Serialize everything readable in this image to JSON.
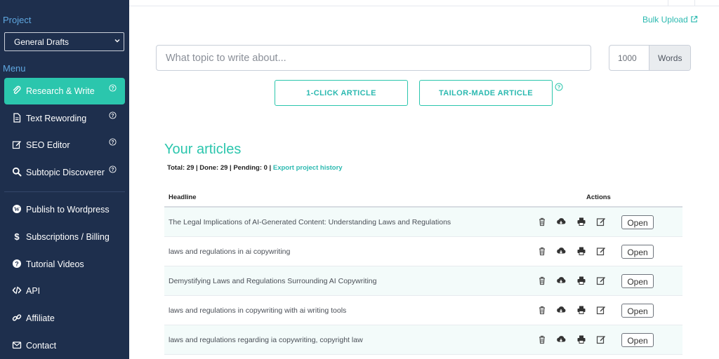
{
  "sidebar": {
    "project_heading": "Project",
    "project_value": "General Drafts",
    "menu_heading": "Menu",
    "items": [
      {
        "label": "Research & Write",
        "icon": "paperclip-icon",
        "help": true,
        "active": true
      },
      {
        "label": "Text Rewording",
        "icon": "document-icon",
        "help": true
      },
      {
        "label": "SEO Editor",
        "icon": "edit-icon",
        "help": true
      },
      {
        "label": "Subtopic Discoverer",
        "icon": "search-icon",
        "help": true
      },
      {
        "label": "Publish to Wordpress",
        "icon": "wordpress-icon"
      },
      {
        "label": "Subscriptions / Billing",
        "icon": "dollar-icon"
      },
      {
        "label": "Tutorial Videos",
        "icon": "question-circle-icon"
      },
      {
        "label": "API",
        "icon": "code-icon"
      },
      {
        "label": "Affiliate",
        "icon": "link-icon"
      },
      {
        "label": "Contact",
        "icon": "envelope-icon"
      }
    ]
  },
  "main": {
    "bulk_upload": "Bulk Upload",
    "topic_placeholder": "What topic to write about...",
    "words_value": "1000",
    "words_unit": "Words",
    "one_click_label": "1-CLICK ARTICLE",
    "tailor_label": "TAILOR-MADE ARTICLE",
    "articles_title": "Your articles",
    "stats": {
      "text": "Total: 29 | Done: 29 | Pending: 0 |",
      "export_link": "Export project history"
    },
    "table": {
      "col_headline": "Headline",
      "col_actions": "Actions",
      "open_label": "Open",
      "rows": [
        "The Legal Implications of AI-Generated Content: Understanding Laws and Regulations",
        "laws and regulations in ai copywriting",
        "Demystifying Laws and Regulations Surrounding AI Copywriting",
        "laws and regulations in copywriting with ai writing tools",
        "laws and regulations regarding ia copywriting, copyright law"
      ]
    }
  },
  "colors": {
    "sidebar_bg": "#1e2f4d",
    "accent": "#2bc6ad",
    "heading_blue": "#5fa7e0"
  }
}
